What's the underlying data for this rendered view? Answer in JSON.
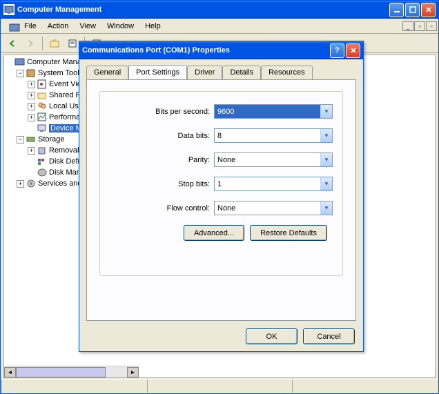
{
  "window": {
    "title": "Computer Management"
  },
  "menu": {
    "file": "File",
    "action": "Action",
    "view": "View",
    "window": "Window",
    "help": "Help"
  },
  "tree": {
    "root": "Computer Manageme",
    "systools": "System Tools",
    "eventview": "Event Viev",
    "sharedfol": "Shared Fo",
    "localuser": "Local User",
    "perf": "Performan",
    "devman": "Device Ma",
    "storage": "Storage",
    "removable": "Removable",
    "defrag": "Disk Defra",
    "diskman": "Disk Mana",
    "services": "Services and A"
  },
  "dialog": {
    "title": "Communications Port (COM1) Properties",
    "tabs": {
      "general": "General",
      "port": "Port Settings",
      "driver": "Driver",
      "details": "Details",
      "resources": "Resources"
    },
    "labels": {
      "bps": "Bits per second:",
      "databits": "Data bits:",
      "parity": "Parity:",
      "stopbits": "Stop bits:",
      "flow": "Flow control:"
    },
    "values": {
      "bps": "9600",
      "databits": "8",
      "parity": "None",
      "stopbits": "1",
      "flow": "None"
    },
    "buttons": {
      "advanced": "Advanced...",
      "restore": "Restore Defaults",
      "ok": "OK",
      "cancel": "Cancel"
    }
  }
}
